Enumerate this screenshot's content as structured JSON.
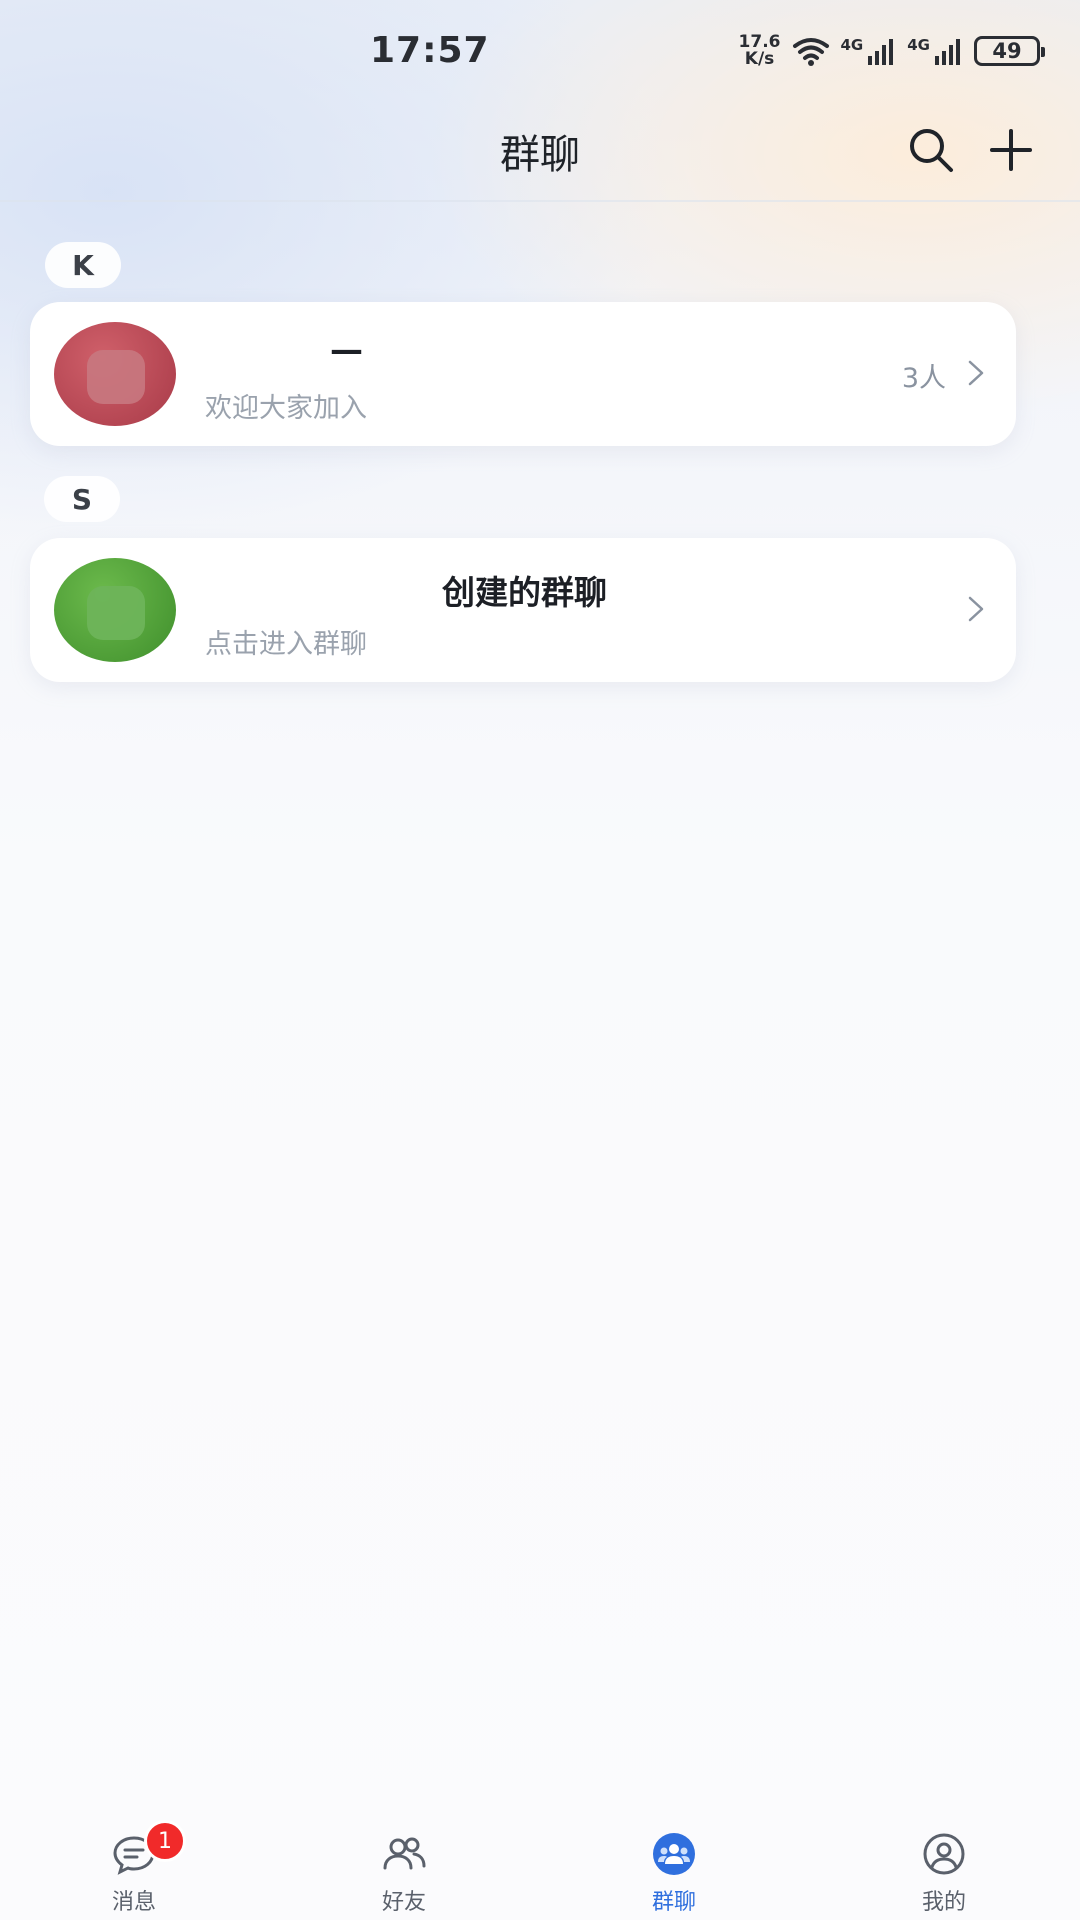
{
  "status_bar": {
    "time": "17:57",
    "net_speed_value": "17.6",
    "net_speed_unit": "K/s",
    "signal_1_label": "4G",
    "signal_2_label": "4G",
    "battery": "49"
  },
  "header": {
    "title": "群聊",
    "search_icon": "search-icon",
    "add_icon": "plus-icon"
  },
  "groups": [
    {
      "index": "K",
      "name": "—",
      "subtitle": "欢迎大家加入",
      "member_count": "3人",
      "avatar_color": "#b9444f"
    },
    {
      "index": "S",
      "name": "创建的群聊",
      "subtitle": "点击进入群聊",
      "member_count": "",
      "avatar_color": "#55a53a"
    }
  ],
  "tab_bar": {
    "tabs": [
      {
        "label": "消息",
        "icon": "message-icon",
        "badge": "1",
        "active": false
      },
      {
        "label": "好友",
        "icon": "friends-icon",
        "active": false
      },
      {
        "label": "群聊",
        "icon": "group-chat-icon",
        "active": true
      },
      {
        "label": "我的",
        "icon": "profile-icon",
        "active": false
      }
    ]
  },
  "colors": {
    "accent": "#2f6fde",
    "badge": "#f12a2a",
    "card_bg": "#ffffff"
  }
}
